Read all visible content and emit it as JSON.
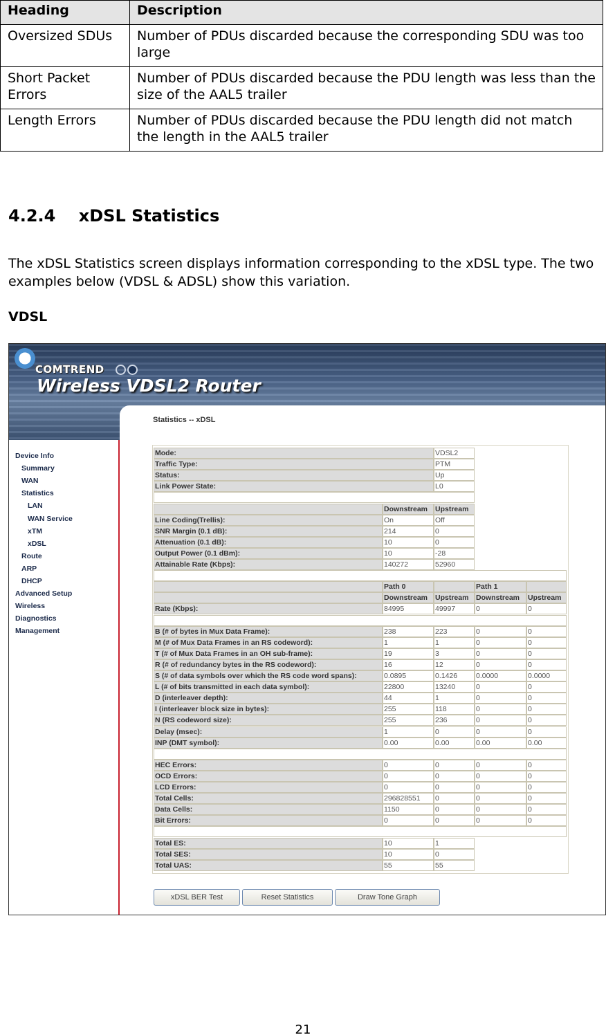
{
  "doc_table": {
    "headers": [
      "Heading",
      "Description"
    ],
    "rows": [
      [
        "Oversized SDUs",
        "Number of PDUs discarded because the corresponding SDU was too large"
      ],
      [
        "Short Packet Errors",
        "Number of PDUs discarded because the PDU length was less than the size of the AAL5 trailer"
      ],
      [
        "Length Errors",
        "Number of PDUs discarded because the PDU length did not match the length in the AAL5 trailer"
      ]
    ]
  },
  "section": {
    "number": "4.2.4",
    "title": "xDSL Statistics",
    "paragraph": "The xDSL Statistics screen displays information corresponding to the xDSL type. The two examples below (VDSL & ADSL) show this variation.",
    "subheading": "VDSL"
  },
  "screenshot": {
    "brand": "COMTREND",
    "product": "Wireless VDSL2 Router",
    "page_title": "Statistics -- xDSL",
    "sidebar": [
      {
        "label": "Device Info",
        "level": 0
      },
      {
        "label": "Summary",
        "level": 1
      },
      {
        "label": "WAN",
        "level": 1
      },
      {
        "label": "Statistics",
        "level": 1
      },
      {
        "label": "LAN",
        "level": 2
      },
      {
        "label": "WAN Service",
        "level": 2
      },
      {
        "label": "xTM",
        "level": 2
      },
      {
        "label": "xDSL",
        "level": 2
      },
      {
        "label": "Route",
        "level": 1
      },
      {
        "label": "ARP",
        "level": 1
      },
      {
        "label": "DHCP",
        "level": 1
      },
      {
        "label": "Advanced Setup",
        "level": 0
      },
      {
        "label": "Wireless",
        "level": 0
      },
      {
        "label": "Diagnostics",
        "level": 0
      },
      {
        "label": "Management",
        "level": 0
      }
    ],
    "stats_rows": [
      {
        "type": "kv",
        "label": "Mode:",
        "values": [
          "VDSL2"
        ]
      },
      {
        "type": "kv",
        "label": "Traffic Type:",
        "values": [
          "PTM"
        ]
      },
      {
        "type": "kv",
        "label": "Status:",
        "values": [
          "Up"
        ]
      },
      {
        "type": "kv",
        "label": "Link Power State:",
        "values": [
          "L0"
        ]
      },
      {
        "type": "blank2"
      },
      {
        "type": "hdr2",
        "label": "",
        "values": [
          "Downstream",
          "Upstream"
        ]
      },
      {
        "type": "two",
        "label": "Line Coding(Trellis):",
        "values": [
          "On",
          "Off"
        ]
      },
      {
        "type": "two",
        "label": "SNR Margin (0.1 dB):",
        "values": [
          "214",
          "0"
        ]
      },
      {
        "type": "two",
        "label": "Attenuation (0.1 dB):",
        "values": [
          "10",
          "0"
        ]
      },
      {
        "type": "two",
        "label": "Output Power (0.1 dBm):",
        "values": [
          "10",
          "-28"
        ]
      },
      {
        "type": "two",
        "label": "Attainable Rate (Kbps):",
        "values": [
          "140272",
          "52960"
        ]
      },
      {
        "type": "blank4"
      },
      {
        "type": "hdr4",
        "label": "",
        "values": [
          "Path 0",
          "",
          "Path 1",
          ""
        ]
      },
      {
        "type": "hdr4",
        "label": "",
        "values": [
          "Downstream",
          "Upstream",
          "Downstream",
          "Upstream"
        ]
      },
      {
        "type": "four",
        "label": "Rate (Kbps):",
        "values": [
          "84995",
          "49997",
          "0",
          "0"
        ]
      },
      {
        "type": "blank4"
      },
      {
        "type": "four",
        "label": "B (# of bytes in Mux Data Frame):",
        "values": [
          "238",
          "223",
          "0",
          "0"
        ]
      },
      {
        "type": "four",
        "label": "M (# of Mux Data Frames in an RS codeword):",
        "values": [
          "1",
          "1",
          "0",
          "0"
        ]
      },
      {
        "type": "four",
        "label": "T (# of Mux Data Frames in an OH sub-frame):",
        "values": [
          "19",
          "3",
          "0",
          "0"
        ]
      },
      {
        "type": "four",
        "label": "R (# of redundancy bytes in the RS codeword):",
        "values": [
          "16",
          "12",
          "0",
          "0"
        ]
      },
      {
        "type": "four",
        "label": "S (# of data symbols over which the RS code word spans):",
        "values": [
          "0.0895",
          "0.1426",
          "0.0000",
          "0.0000"
        ]
      },
      {
        "type": "four",
        "label": "L (# of bits transmitted in each data symbol):",
        "values": [
          "22800",
          "13240",
          "0",
          "0"
        ]
      },
      {
        "type": "four",
        "label": "D (interleaver depth):",
        "values": [
          "44",
          "1",
          "0",
          "0"
        ]
      },
      {
        "type": "four",
        "label": "I (interleaver block size in bytes):",
        "values": [
          "255",
          "118",
          "0",
          "0"
        ]
      },
      {
        "type": "four",
        "label": "N (RS codeword size):",
        "values": [
          "255",
          "236",
          "0",
          "0"
        ]
      },
      {
        "type": "four",
        "label": "Delay (msec):",
        "values": [
          "1",
          "0",
          "0",
          "0"
        ]
      },
      {
        "type": "four",
        "label": "INP (DMT symbol):",
        "values": [
          "0.00",
          "0.00",
          "0.00",
          "0.00"
        ]
      },
      {
        "type": "blank4"
      },
      {
        "type": "four",
        "label": "HEC Errors:",
        "values": [
          "0",
          "0",
          "0",
          "0"
        ]
      },
      {
        "type": "four",
        "label": "OCD Errors:",
        "values": [
          "0",
          "0",
          "0",
          "0"
        ]
      },
      {
        "type": "four",
        "label": "LCD Errors:",
        "values": [
          "0",
          "0",
          "0",
          "0"
        ]
      },
      {
        "type": "four",
        "label": "Total Cells:",
        "values": [
          "296828551",
          "0",
          "0",
          "0"
        ]
      },
      {
        "type": "four",
        "label": "Data Cells:",
        "values": [
          "1150",
          "0",
          "0",
          "0"
        ]
      },
      {
        "type": "four",
        "label": "Bit Errors:",
        "values": [
          "0",
          "0",
          "0",
          "0"
        ]
      },
      {
        "type": "blank4"
      },
      {
        "type": "two",
        "label": "Total ES:",
        "values": [
          "10",
          "1"
        ]
      },
      {
        "type": "two",
        "label": "Total SES:",
        "values": [
          "10",
          "0"
        ]
      },
      {
        "type": "two",
        "label": "Total UAS:",
        "values": [
          "55",
          "55"
        ]
      }
    ],
    "buttons": [
      "xDSL BER Test",
      "Reset Statistics",
      "Draw Tone Graph"
    ]
  },
  "page_number": "21"
}
